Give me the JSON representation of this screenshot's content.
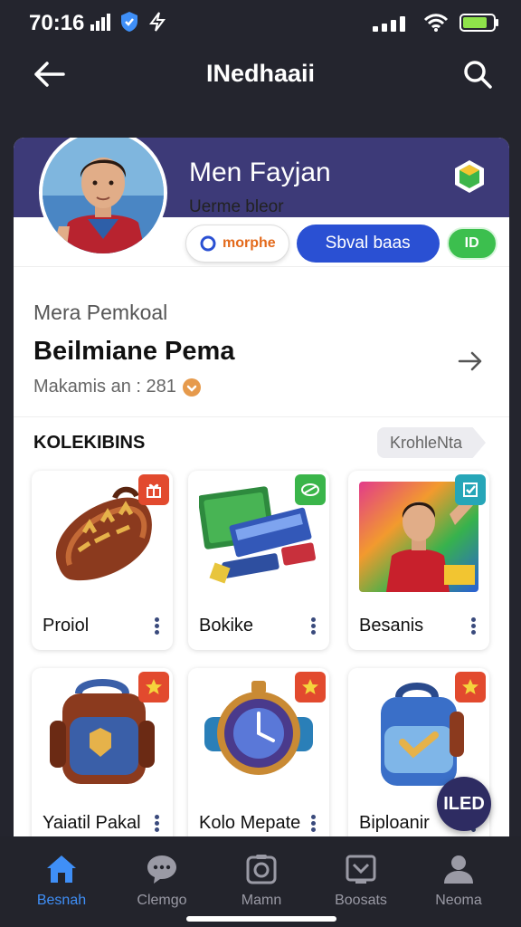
{
  "status_bar": {
    "time": "70:16"
  },
  "header": {
    "title": "INedhaaii"
  },
  "profile": {
    "name": "Men Fayjan",
    "subtitle": "Uerme bleor",
    "chip_outline_label": "morphe",
    "chip_primary_label": "Sbval baas",
    "chip_green_label": "ID"
  },
  "main_pitch": {
    "label": "Mera Pemkoal",
    "title": "Beilmiane Pema",
    "meta": "Makamis an : 281"
  },
  "collections": {
    "title": "KOLEKIBINS",
    "pill_label": "KrohleNta",
    "items": [
      {
        "label": "Proiol",
        "badge_color": "#e24a2e",
        "art": "bag"
      },
      {
        "label": "Bokike",
        "badge_color": "#3ab54a",
        "art": "boxes"
      },
      {
        "label": "Besanis",
        "badge_color": "#26a6b8",
        "art": "player-card"
      },
      {
        "label": "Yaiatil Pakal",
        "badge_color": "#e24a2e",
        "art": "backpack"
      },
      {
        "label": "Kolo Mepate",
        "badge_color": "#e24a2e",
        "art": "watch"
      },
      {
        "label": "Biploanir",
        "badge_color": "#e24a2e",
        "art": "blue-backpack"
      }
    ]
  },
  "fab": {
    "label": "ILED"
  },
  "bottom_nav": [
    {
      "label": "Besnah",
      "icon": "home-icon",
      "active": true
    },
    {
      "label": "Clemgo",
      "icon": "chat-icon",
      "active": false
    },
    {
      "label": "Mamn",
      "icon": "camera-icon",
      "active": false
    },
    {
      "label": "Boosats",
      "icon": "inbox-icon",
      "active": false
    },
    {
      "label": "Neoma",
      "icon": "person-icon",
      "active": false
    }
  ]
}
